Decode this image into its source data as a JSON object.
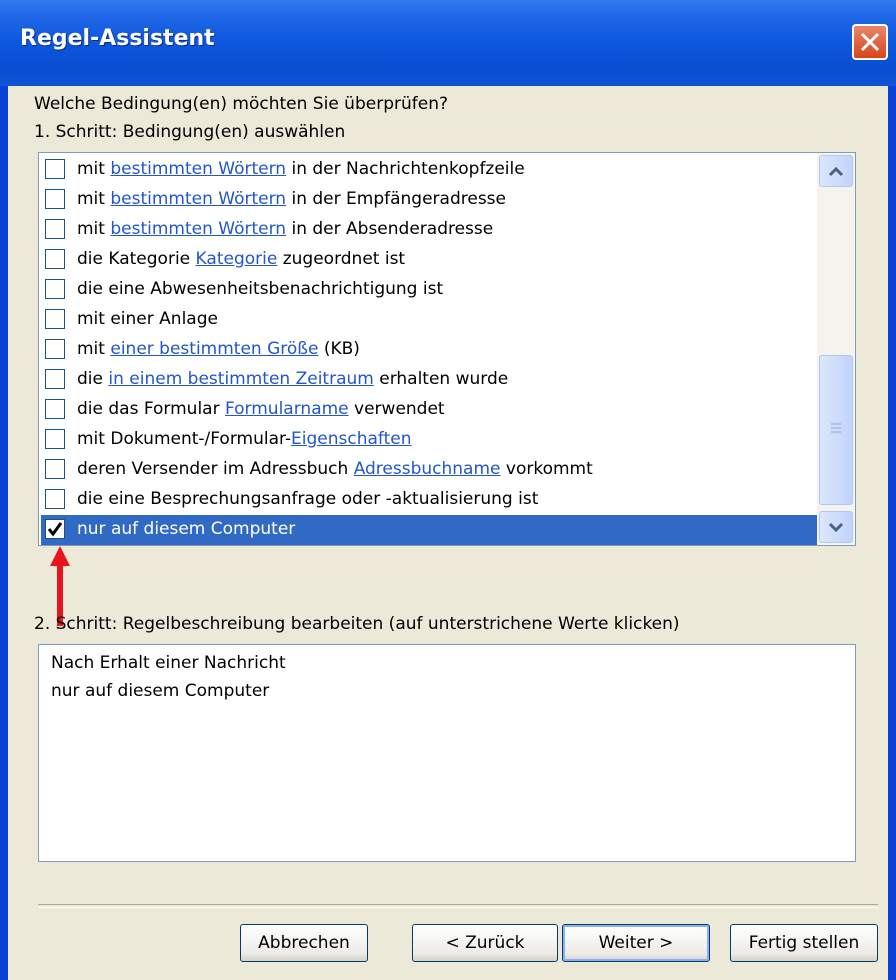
{
  "window": {
    "title": "Regel-Assistent"
  },
  "prompt": "Welche Bedingung(en) möchten Sie überprüfen?",
  "step1_label": "1. Schritt: Bedingung(en) auswählen",
  "conditions": [
    {
      "pre": "mit ",
      "link": "bestimmten Wörtern",
      "post": " in der Nachrichtenkopfzeile",
      "checked": false
    },
    {
      "pre": "mit ",
      "link": "bestimmten Wörtern",
      "post": " in der Empfängeradresse",
      "checked": false
    },
    {
      "pre": "mit ",
      "link": "bestimmten Wörtern",
      "post": " in der Absenderadresse",
      "checked": false
    },
    {
      "pre": "die Kategorie ",
      "link": "Kategorie",
      "post": " zugeordnet ist",
      "checked": false
    },
    {
      "pre": "die eine Abwesenheitsbenachrichtigung ist",
      "link": "",
      "post": "",
      "checked": false
    },
    {
      "pre": "mit einer Anlage",
      "link": "",
      "post": "",
      "checked": false
    },
    {
      "pre": "mit ",
      "link": "einer bestimmten Größe",
      "post": " (KB)",
      "checked": false
    },
    {
      "pre": "die ",
      "link": "in einem bestimmten Zeitraum",
      "post": " erhalten wurde",
      "checked": false
    },
    {
      "pre": "die das Formular ",
      "link": "Formularname",
      "post": " verwendet",
      "checked": false
    },
    {
      "pre": "mit Dokument-/Formular-",
      "link": "Eigenschaften",
      "post": "",
      "checked": false
    },
    {
      "pre": "deren Versender im Adressbuch ",
      "link": "Adressbuchname",
      "post": " vorkommt",
      "checked": false
    },
    {
      "pre": "die eine Besprechungsanfrage oder -aktualisierung ist",
      "link": "",
      "post": "",
      "checked": false
    },
    {
      "pre": "nur auf diesem Computer",
      "link": "",
      "post": "",
      "checked": true,
      "selected": true
    }
  ],
  "step2_label": "2. Schritt: Regelbeschreibung bearbeiten (auf unterstrichene Werte klicken)",
  "description": {
    "line1": "Nach Erhalt einer Nachricht",
    "line2": "nur auf diesem Computer"
  },
  "buttons": {
    "cancel": "Abbrechen",
    "back": "< Zurück",
    "next": "Weiter >",
    "finish": "Fertig stellen"
  },
  "colors": {
    "title_bar": "#0a4ed2",
    "selection": "#316ac5",
    "link": "#2256c9",
    "annotation_arrow": "#e8141e"
  }
}
